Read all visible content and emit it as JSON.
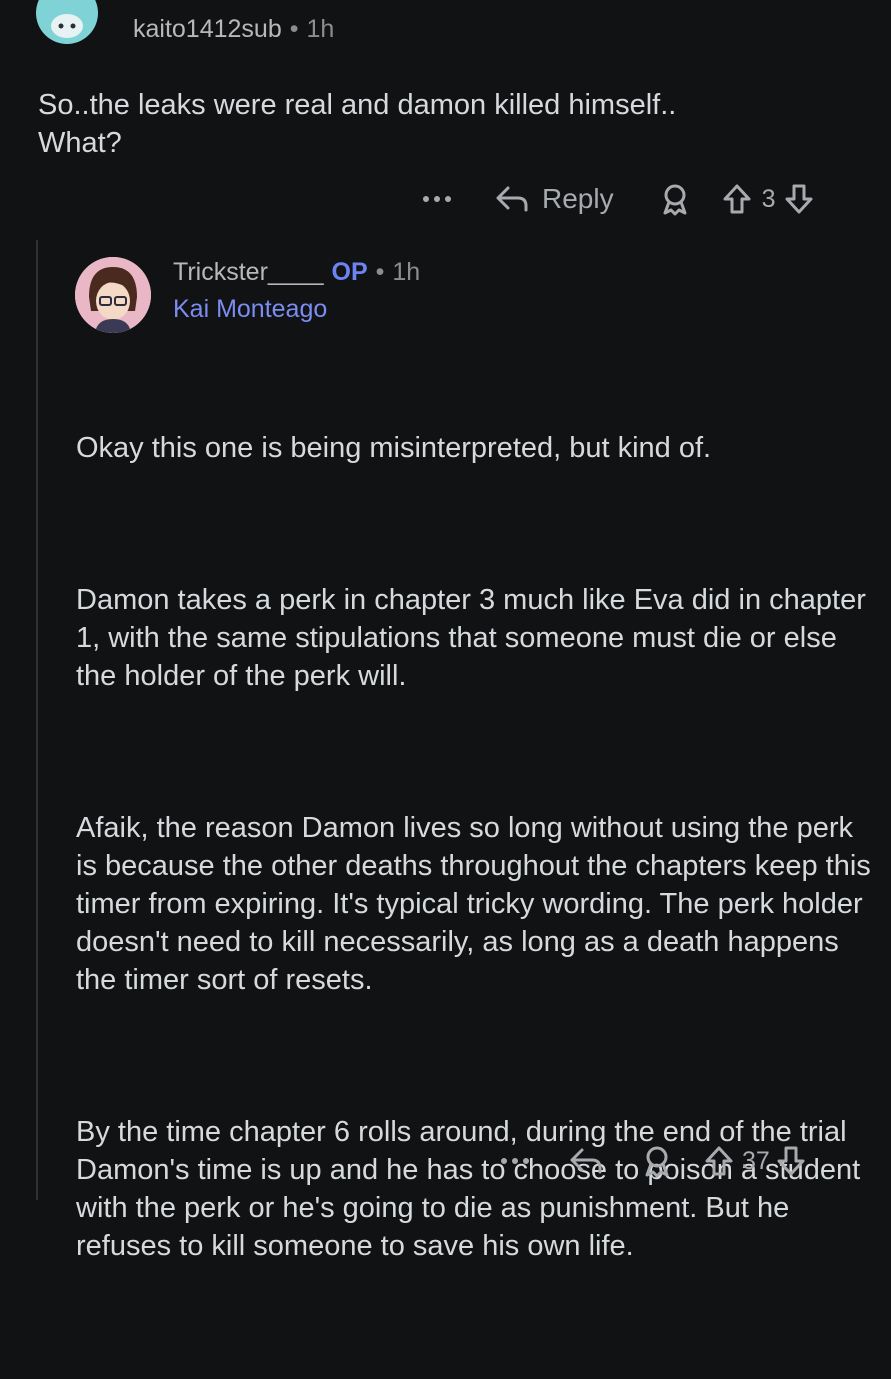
{
  "top_comment": {
    "username": "kaito1412sub",
    "separator": "•",
    "time": "1h",
    "body": "So..the leaks were real and damon killed himself..\nWhat?",
    "actions": {
      "more": "•••",
      "reply_label": "Reply",
      "score": "3"
    }
  },
  "reply_comment": {
    "username": "Trickster____",
    "op_badge": "OP",
    "separator": "•",
    "time": "1h",
    "flair": "Kai Monteago",
    "paragraphs": [
      "Okay this one is being misinterpreted, but kind of.",
      "Damon takes a perk in chapter 3 much like Eva did in chapter 1, with the same stipulations that someone must die or else the holder of the perk will.",
      "Afaik, the reason Damon lives so long without using the perk is because the other deaths throughout the chapters keep this timer from expiring. It's typical tricky wording. The perk holder doesn't need to kill necessarily, as long as a death happens the timer sort of resets.",
      "By the time chapter 6 rolls around, during the end of the trial Damon's time is up and he has to choose to poison a student with the perk or he's going to die as punishment. But he refuses to kill someone to save his own life."
    ],
    "actions": {
      "more": "•••",
      "score": "37"
    }
  },
  "icons": {
    "more": "more-options-icon",
    "reply": "reply-arrow-icon",
    "award": "award-icon",
    "upvote": "upvote-icon",
    "downvote": "downvote-icon"
  },
  "colors": {
    "background": "#111214",
    "text": "#d7dadc",
    "muted": "#8b8e90",
    "op_accent": "#6e83f2",
    "flair": "#7c8cf0"
  }
}
